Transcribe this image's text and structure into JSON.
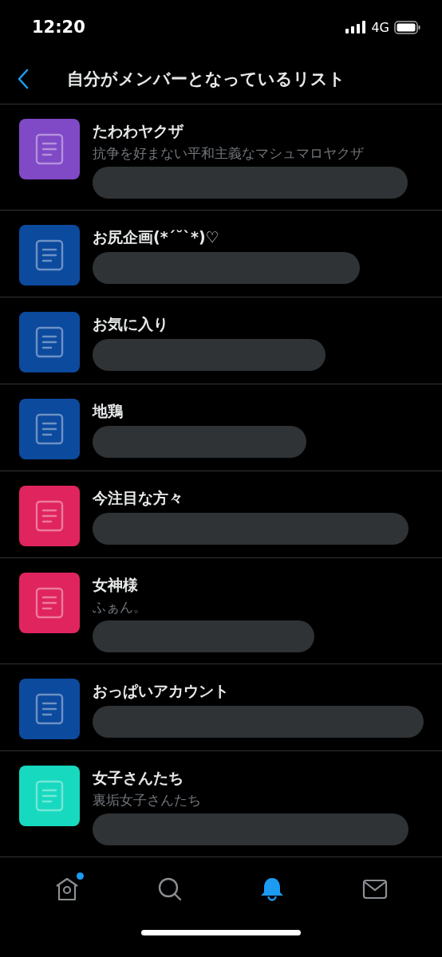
{
  "status_bar": {
    "time": "12:20",
    "network": "4G"
  },
  "header": {
    "title": "自分がメンバーとなっているリスト"
  },
  "lists": [
    {
      "name": "たわわヤクザ",
      "description": "抗争を好まない平和主義なマシュマロヤクザ",
      "color": "#8049c6",
      "redacted": true
    },
    {
      "name": "お尻企画(*´˘`*)♡",
      "color": "#0c4a9e",
      "redacted": true
    },
    {
      "name": "お気に入り",
      "color": "#0c4a9e",
      "redacted": true
    },
    {
      "name": "地鶏",
      "color": "#0c4a9e",
      "redacted": true
    },
    {
      "name": "今注目な方々",
      "color": "#e0245e",
      "redacted": true
    },
    {
      "name": "女神様",
      "description": "ふぁん。",
      "color": "#e0245e",
      "redacted": true
    },
    {
      "name": "おっぱいアカウント",
      "color": "#0c4a9e",
      "redacted": true
    },
    {
      "name": "女子さんたち",
      "description": "裏垢女子さんたち",
      "color": "#17d9bf",
      "redacted": true
    }
  ],
  "tab_bar": [
    {
      "kind": "home",
      "selected": false,
      "badge": true
    },
    {
      "kind": "search",
      "selected": false,
      "badge": false
    },
    {
      "kind": "notifications",
      "selected": true,
      "badge": false
    },
    {
      "kind": "messages",
      "selected": false,
      "badge": false
    }
  ]
}
